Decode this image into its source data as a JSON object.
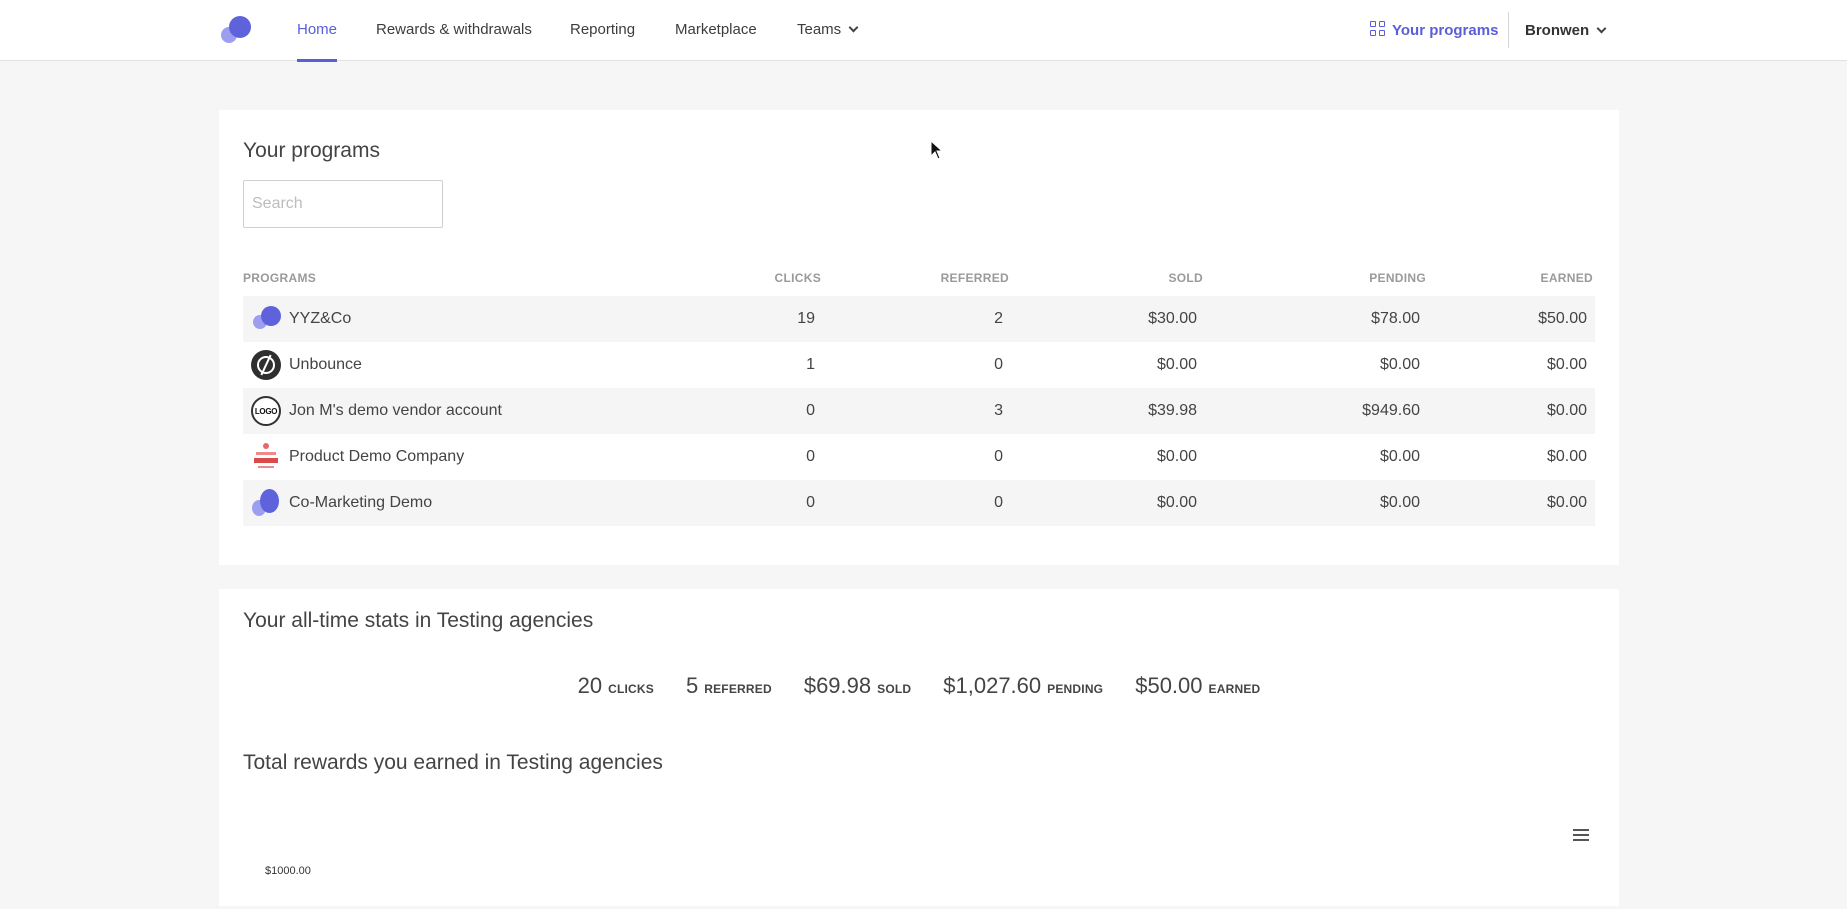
{
  "nav": {
    "links": [
      {
        "label": "Home",
        "active": true
      },
      {
        "label": "Rewards & withdrawals"
      },
      {
        "label": "Reporting"
      },
      {
        "label": "Marketplace"
      },
      {
        "label": "Teams"
      }
    ],
    "your_programs": "Your programs",
    "user": "Bronwen"
  },
  "programs_card": {
    "title": "Your programs",
    "search_placeholder": "Search",
    "headers": [
      "PROGRAMS",
      "CLICKS",
      "REFERRED",
      "SOLD",
      "PENDING",
      "EARNED"
    ],
    "rows": [
      {
        "name": "YYZ&Co",
        "clicks": "19",
        "referred": "2",
        "sold": "$30.00",
        "pending": "$78.00",
        "earned": "$50.00",
        "logo": "yyz-logo"
      },
      {
        "name": "Unbounce",
        "clicks": "1",
        "referred": "0",
        "sold": "$0.00",
        "pending": "$0.00",
        "earned": "$0.00",
        "logo": "unbounce-logo"
      },
      {
        "name": "Jon M's demo vendor account",
        "clicks": "0",
        "referred": "3",
        "sold": "$39.98",
        "pending": "$949.60",
        "earned": "$0.00",
        "logo": "jon-logo",
        "logo_text": "LOGO"
      },
      {
        "name": "Product Demo Company",
        "clicks": "0",
        "referred": "0",
        "sold": "$0.00",
        "pending": "$0.00",
        "earned": "$0.00",
        "logo": "product-demo-logo"
      },
      {
        "name": "Co-Marketing Demo",
        "clicks": "0",
        "referred": "0",
        "sold": "$0.00",
        "pending": "$0.00",
        "earned": "$0.00",
        "logo": "co-marketing-logo"
      }
    ]
  },
  "stats_card": {
    "title": "Your all-time stats in Testing agencies",
    "stats": [
      {
        "value": "20",
        "label": "CLICKS"
      },
      {
        "value": "5",
        "label": "REFERRED"
      },
      {
        "value": "$69.98",
        "label": "SOLD"
      },
      {
        "value": "$1,027.60",
        "label": "PENDING"
      },
      {
        "value": "$50.00",
        "label": "EARNED"
      }
    ],
    "rewards_title": "Total rewards you earned in Testing agencies",
    "chart_tick": "$1000.00"
  },
  "colors": {
    "accent": "#5a5fd8",
    "accent_light": "#9c9ff0",
    "background": "#f6f6f6"
  }
}
